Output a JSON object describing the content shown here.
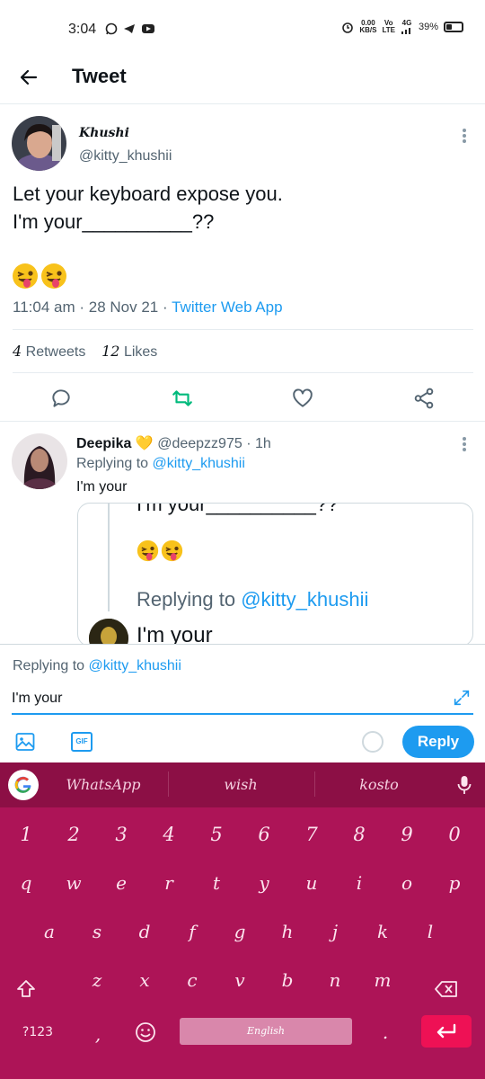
{
  "status_bar": {
    "time": "3:04",
    "net_speed_top": "0.00",
    "net_speed_unit": "KB/S",
    "volte_top": "Vo",
    "volte_bottom": "LTE",
    "signal_label": "4G",
    "battery": "39%",
    "battery_level": 0.39
  },
  "header": {
    "title": "Tweet"
  },
  "tweet": {
    "author_name": "Khushi",
    "author_handle": "@kitty_khushii",
    "line1": "Let your keyboard expose you.",
    "line2": "I'm your__________??",
    "emojis": [
      "😜",
      "😜"
    ],
    "time": "11:04 am",
    "date": "28 Nov 21",
    "dot": "·",
    "source": "Twitter Web App",
    "retweet_count": "4",
    "retweets_label": "Retweets",
    "like_count": "12",
    "likes_label": "Likes"
  },
  "reply": {
    "author_name": "Deepika",
    "heart": "💛",
    "handle": "@deepzz975",
    "time": "· 1h",
    "replying_prefix": "Replying to",
    "replying_handle": "@kitty_khushii",
    "text": "I'm your",
    "quoted_text": "I'm your__________??",
    "quoted_emojis": [
      "😜",
      "😜"
    ],
    "quoted_replying_prefix": "Replying to",
    "quoted_replying_handle": "@kitty_khushii",
    "quoted_reply_text": "I'm your"
  },
  "composer": {
    "replying_prefix": "Replying to",
    "replying_handle": "@kitty_khushii",
    "input_value": "I'm your",
    "gif_label": "GIF",
    "reply_button": "Reply"
  },
  "keyboard": {
    "suggestions": [
      "WhatsApp",
      "wish",
      "kosto"
    ],
    "number_row": [
      "1",
      "2",
      "3",
      "4",
      "5",
      "6",
      "7",
      "8",
      "9",
      "0"
    ],
    "row1": [
      "q",
      "w",
      "e",
      "r",
      "t",
      "y",
      "u",
      "i",
      "o",
      "p"
    ],
    "row2": [
      "a",
      "s",
      "d",
      "f",
      "g",
      "h",
      "j",
      "k",
      "l"
    ],
    "row3": [
      "z",
      "x",
      "c",
      "v",
      "b",
      "n",
      "m"
    ],
    "symbols_key": "?123",
    "comma_key": ",",
    "space_label": "English",
    "period_key": ".",
    "colors": {
      "background": "#ad1457",
      "suggestion_bar": "#8c0f45",
      "enter": "#ee1155"
    }
  },
  "colors": {
    "accent": "#1d9bf0",
    "retweet_green": "#00ba7c"
  }
}
